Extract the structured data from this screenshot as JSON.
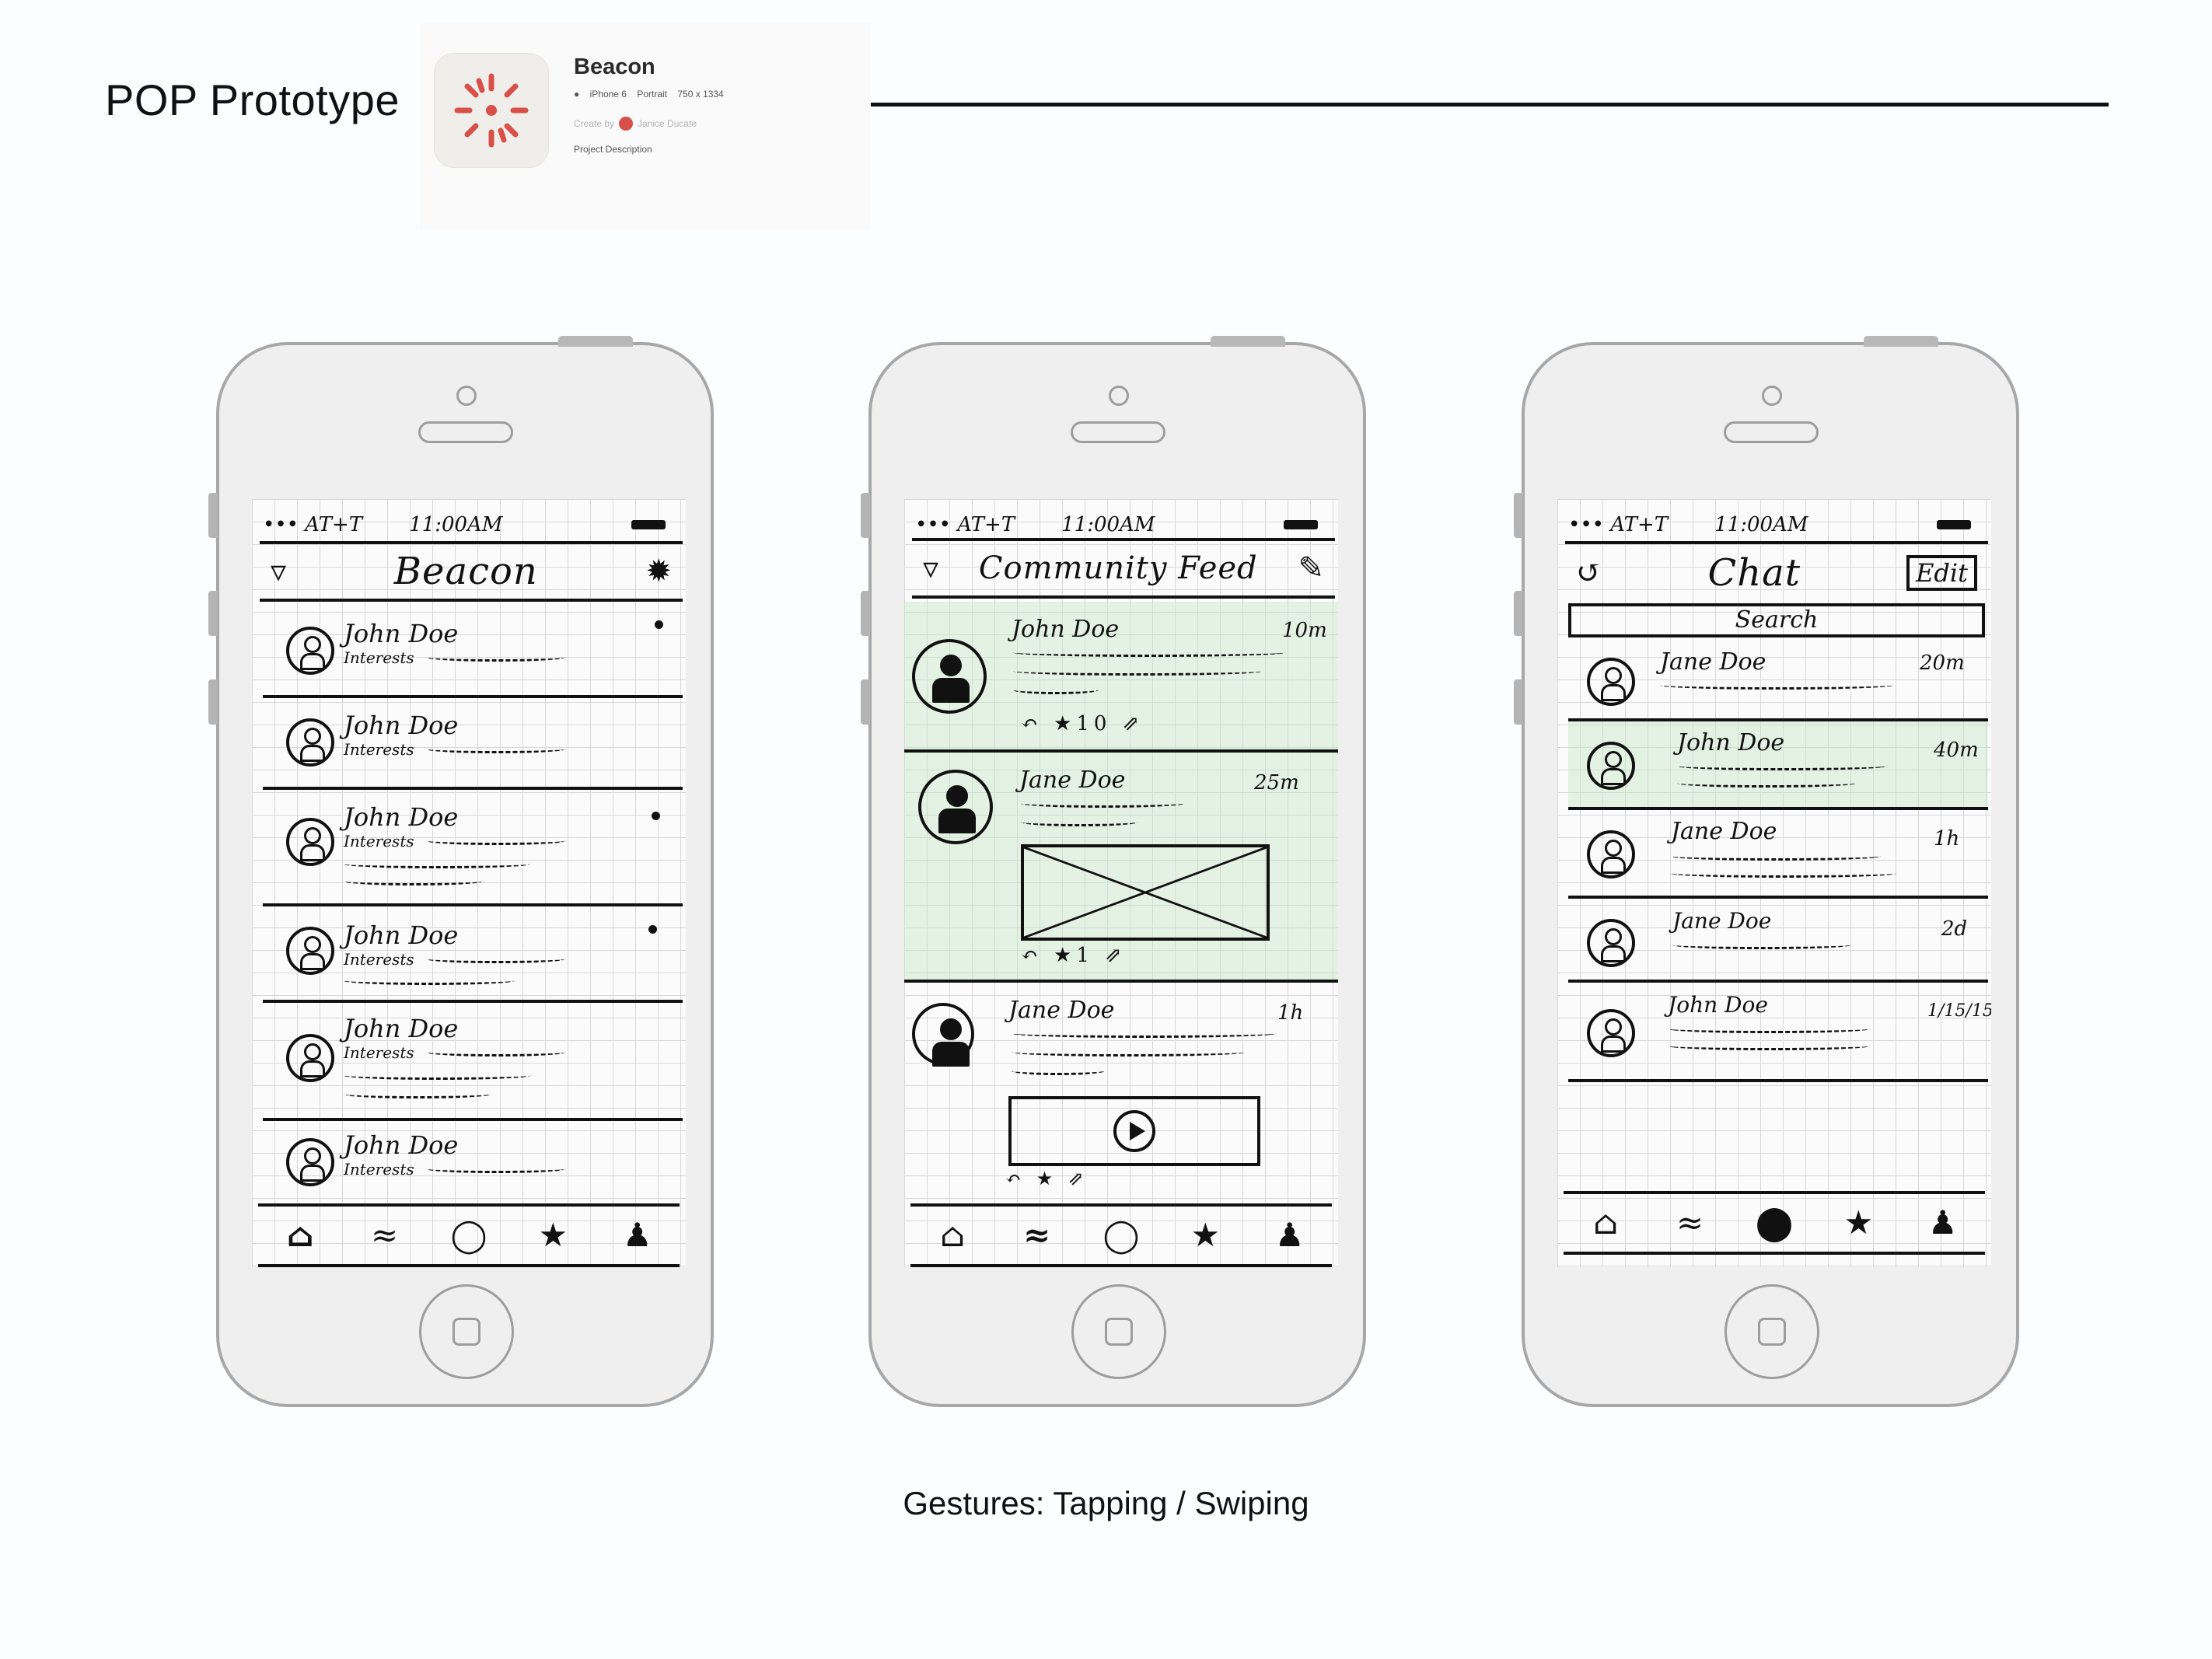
{
  "header": {
    "title": "POP Prototype"
  },
  "project_card": {
    "name": "Beacon",
    "platform_icon": "apple-icon",
    "device": "iPhone 6",
    "orientation": "Portrait",
    "resolution": "750 x 1334",
    "created_by_label": "Create by",
    "creator": "Janice Ducate",
    "description_link": "Project Description",
    "icon_color": "#d8504a"
  },
  "phones": [
    {
      "status": {
        "carrier": "••• AT+T",
        "time": "11:00AM"
      },
      "nav": {
        "left_icon": "filter-icon",
        "title": "Beacon",
        "right_icon": "gear-icon"
      },
      "rows": [
        {
          "name": "John Doe",
          "sub": "Interests",
          "unread": true
        },
        {
          "name": "John Doe",
          "sub": "Interests",
          "unread": false
        },
        {
          "name": "John Doe",
          "sub": "Interests",
          "unread": true
        },
        {
          "name": "John Doe",
          "sub": "Interests",
          "unread": true
        },
        {
          "name": "John Doe",
          "sub": "Interests",
          "unread": false
        },
        {
          "name": "John Doe",
          "sub": "Interests",
          "unread": false
        }
      ],
      "tabs": [
        "home-icon",
        "feed-icon",
        "chat-icon",
        "star-icon",
        "profile-icon"
      ],
      "active_tab": 0
    },
    {
      "status": {
        "carrier": "••• AT+T",
        "time": "11:00AM"
      },
      "nav": {
        "left_icon": "filter-icon",
        "title": "Community Feed",
        "right_icon": "compose-icon"
      },
      "posts": [
        {
          "name": "John Doe",
          "ago": "10m",
          "actions": "↶ ★10 ⇗",
          "media": "none"
        },
        {
          "name": "Jane Doe",
          "ago": "25m",
          "actions": "↶ ★1 ⇗",
          "media": "image"
        },
        {
          "name": "Jane Doe",
          "ago": "1h",
          "actions": "↶ ★ ⇗",
          "media": "video"
        }
      ],
      "tabs": [
        "home-icon",
        "feed-icon",
        "chat-icon",
        "star-icon",
        "profile-icon"
      ],
      "active_tab": 1
    },
    {
      "status": {
        "carrier": "••• AT+T",
        "time": "11:00AM"
      },
      "nav": {
        "left_icon": "back-icon",
        "title": "Chat",
        "right_label": "Edit"
      },
      "search_placeholder": "Search",
      "chats": [
        {
          "name": "Jane Doe",
          "ago": "20m"
        },
        {
          "name": "John Doe",
          "ago": "40m"
        },
        {
          "name": "Jane Doe",
          "ago": "1h"
        },
        {
          "name": "Jane Doe",
          "ago": "2d"
        },
        {
          "name": "John Doe",
          "ago": "1/15/15"
        }
      ],
      "tabs": [
        "home-icon",
        "feed-icon",
        "chat-icon",
        "star-icon",
        "profile-icon"
      ],
      "active_tab": 2
    }
  ],
  "caption": "Gestures: Tapping / Swiping"
}
